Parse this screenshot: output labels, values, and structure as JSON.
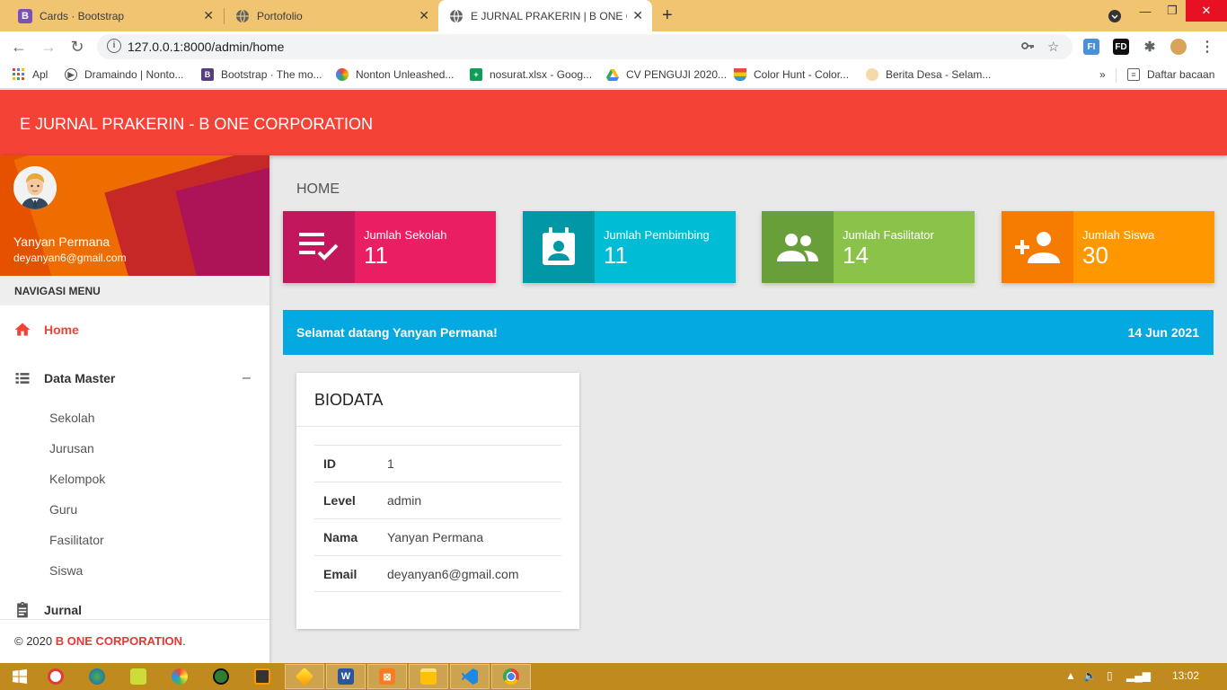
{
  "browser": {
    "tabs": [
      {
        "label": "Cards · Bootstrap",
        "favicon": "B"
      },
      {
        "label": "Portofolio",
        "favicon": "globe"
      },
      {
        "label": "E JURNAL PRAKERIN | B ONE CO",
        "favicon": "globe"
      }
    ],
    "url": "127.0.0.1:8000/admin/home",
    "bookmarks": [
      {
        "label": "Apl"
      },
      {
        "label": "Dramaindo | Nonto..."
      },
      {
        "label": "Bootstrap · The mo..."
      },
      {
        "label": "Nonton Unleashed..."
      },
      {
        "label": "nosurat.xlsx - Goog..."
      },
      {
        "label": "CV PENGUJI 2020..."
      },
      {
        "label": "Color Hunt - Color..."
      },
      {
        "label": "Berita Desa - Selam..."
      }
    ],
    "reading_list": "Daftar bacaan",
    "overflow": "»"
  },
  "app": {
    "title": "E JURNAL PRAKERIN - B ONE CORPORATION",
    "accent": "#f44336"
  },
  "sidebar": {
    "user_name": "Yanyan Permana",
    "user_email": "deyanyan6@gmail.com",
    "nav_header": "NAVIGASI MENU",
    "home": "Home",
    "data_master": "Data Master",
    "collapse": "–",
    "submenu": [
      "Sekolah",
      "Jurusan",
      "Kelompok",
      "Guru",
      "Fasilitator",
      "Siswa"
    ],
    "jurnal": "Jurnal",
    "footer_prefix": "© 2020 ",
    "footer_brand": "B ONE CORPORATION",
    "footer_suffix": "."
  },
  "page": {
    "title": "HOME",
    "cards": [
      {
        "title": "Jumlah Sekolah",
        "value": "11",
        "color": "#e91e63",
        "icon_bg": "#c2185b",
        "icon": "playlist-check-icon"
      },
      {
        "title": "Jumlah Pembimbing",
        "value": "11",
        "color": "#00bcd4",
        "icon_bg": "#0097a7",
        "icon": "contact-calendar-icon"
      },
      {
        "title": "Jumlah Fasilitator",
        "value": "14",
        "color": "#8bc34a",
        "icon_bg": "#689f38",
        "icon": "people-icon"
      },
      {
        "title": "Jumlah Siswa",
        "value": "30",
        "color": "#ff9800",
        "icon_bg": "#f57c00",
        "icon": "person-add-icon"
      }
    ],
    "welcome": "Selamat datang Yanyan Permana!",
    "date": "14 Jun 2021",
    "biodata": {
      "title": "BIODATA",
      "rows": [
        {
          "key": "ID",
          "value": "1"
        },
        {
          "key": "Level",
          "value": "admin"
        },
        {
          "key": "Nama",
          "value": "Yanyan Permana"
        },
        {
          "key": "Email",
          "value": "deyanyan6@gmail.com"
        }
      ]
    }
  },
  "taskbar": {
    "time": "13:02"
  }
}
